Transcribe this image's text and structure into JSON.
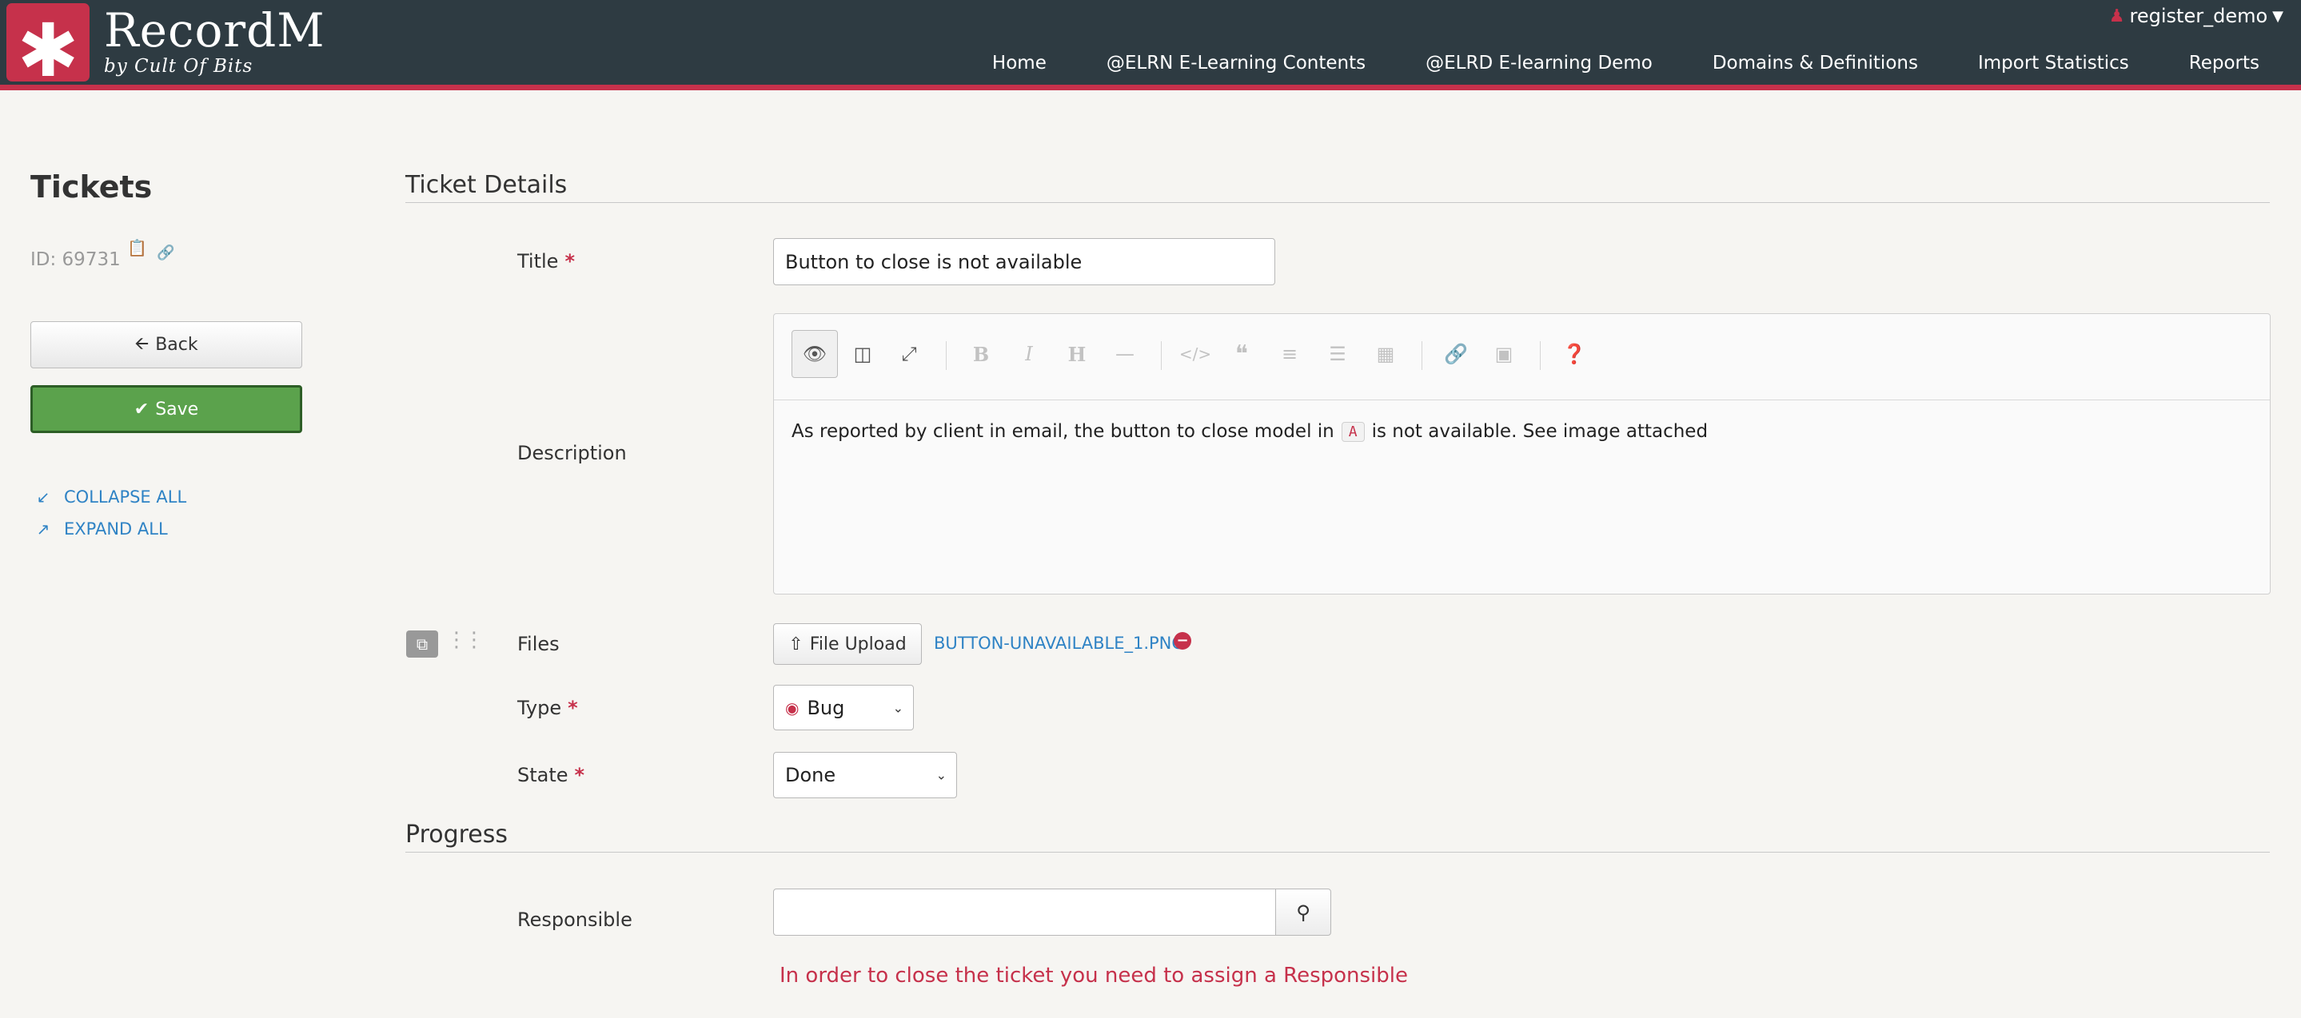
{
  "app": {
    "logo_glyph": "✱",
    "name": "RecordM",
    "tagline": "by Cult Of Bits",
    "user": "register_demo"
  },
  "nav": [
    {
      "label": "Home"
    },
    {
      "label": "@ELRN E-Learning Contents"
    },
    {
      "label": "@ELRD E-learning Demo"
    },
    {
      "label": "Domains & Definitions"
    },
    {
      "label": "Import Statistics"
    },
    {
      "label": "Reports"
    }
  ],
  "sidebar": {
    "title": "Tickets",
    "id_text": "ID: 69731",
    "back_label": "Back",
    "save_label": "Save",
    "collapse_label": "COLLAPSE ALL",
    "expand_label": "EXPAND ALL"
  },
  "section_details": {
    "title": "Ticket Details",
    "title_label": "Title",
    "title_value": "Button to close is not available",
    "description_label": "Description",
    "description_before": "As reported by client in email, the button to close model in",
    "description_code": "A",
    "description_after": "is not available. See image attached",
    "files_label": "Files",
    "upload_label": "File Upload",
    "file_name": "BUTTON-UNAVAILABLE_1.PNG",
    "type_label": "Type",
    "type_value": "Bug",
    "state_label": "State",
    "state_value": "Done"
  },
  "section_progress": {
    "title": "Progress",
    "responsible_label": "Responsible",
    "responsible_value": "",
    "error": "In order to close the ticket you need to assign a Responsible"
  },
  "colors": {
    "header_bg": "#2e3b42",
    "accent": "#c6314b",
    "save_green": "#5ba24c",
    "link_blue": "#2f83c5"
  }
}
